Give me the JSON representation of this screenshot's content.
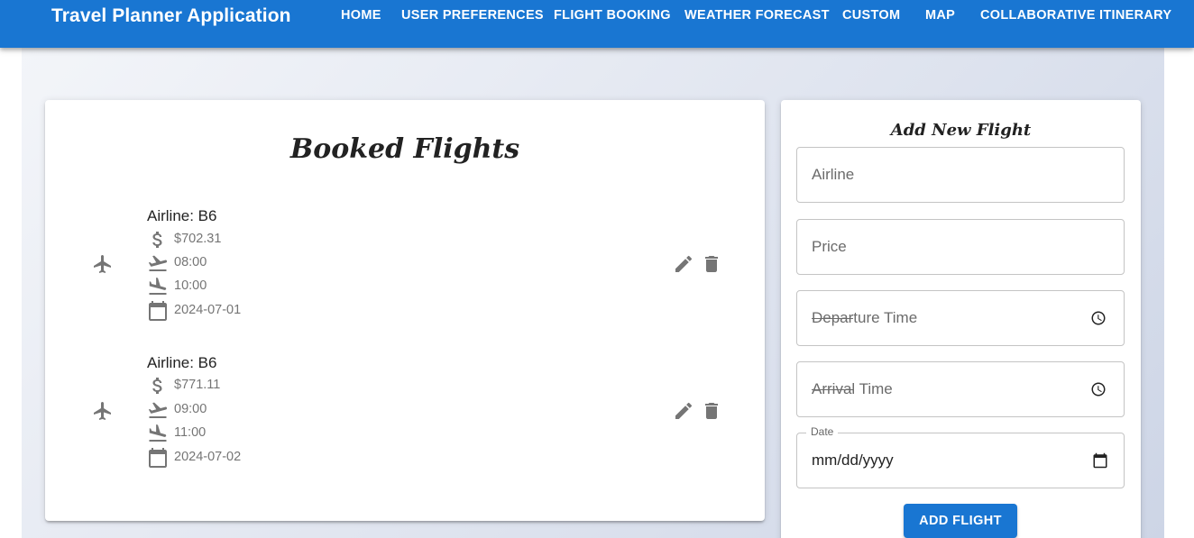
{
  "app": {
    "title": "Travel Planner Application"
  },
  "nav": {
    "home": "HOME",
    "preferences": "USER PREFERENCES",
    "flight_booking": "FLIGHT BOOKING",
    "weather": "WEATHER FORECAST",
    "custom": "CUSTOM",
    "map": "MAP",
    "itinerary": "COLLABORATIVE ITINERARY"
  },
  "booked": {
    "title": "Booked Flights",
    "flights": [
      {
        "airline": "Airline: B6",
        "price": "$702.31",
        "departure": "08:00",
        "arrival": "10:00",
        "date": "2024-07-01"
      },
      {
        "airline": "Airline: B6",
        "price": "$771.11",
        "departure": "09:00",
        "arrival": "11:00",
        "date": "2024-07-02"
      }
    ]
  },
  "form": {
    "title": "Add New Flight",
    "airline_placeholder": "Airline",
    "price_placeholder": "Price",
    "departure_placeholder": "Departure Time",
    "arrival_placeholder": "Arrival Time",
    "date_label": "Date",
    "date_value": "mm/dd/yyyy",
    "submit_label": "ADD FLIGHT"
  },
  "colors": {
    "primary": "#1976d2",
    "icon": "#757575"
  },
  "icons": [
    "airplane-icon",
    "dollar-icon",
    "flight-takeoff-icon",
    "flight-land-icon",
    "calendar-icon",
    "edit-icon",
    "delete-icon",
    "clock-icon"
  ]
}
